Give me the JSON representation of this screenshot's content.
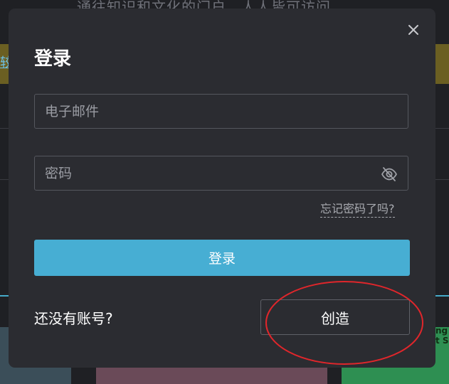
{
  "background": {
    "tagline": "通往知识和文化的门户。人人皆可访问。",
    "banner_link": "较",
    "thumb_text": "ng\nt S"
  },
  "modal": {
    "title": "登录",
    "email_placeholder": "电子邮件",
    "password_placeholder": "密码",
    "forgot_label": "忘记密码了吗?",
    "login_label": "登录",
    "no_account_label": "还没有账号?",
    "create_label": "创造"
  },
  "icons": {
    "close": "close-icon",
    "password_visibility": "eye-slash-icon"
  },
  "colors": {
    "modal_bg": "#2b2c31",
    "primary_button": "#47aed3",
    "annotation": "#e0262b"
  }
}
